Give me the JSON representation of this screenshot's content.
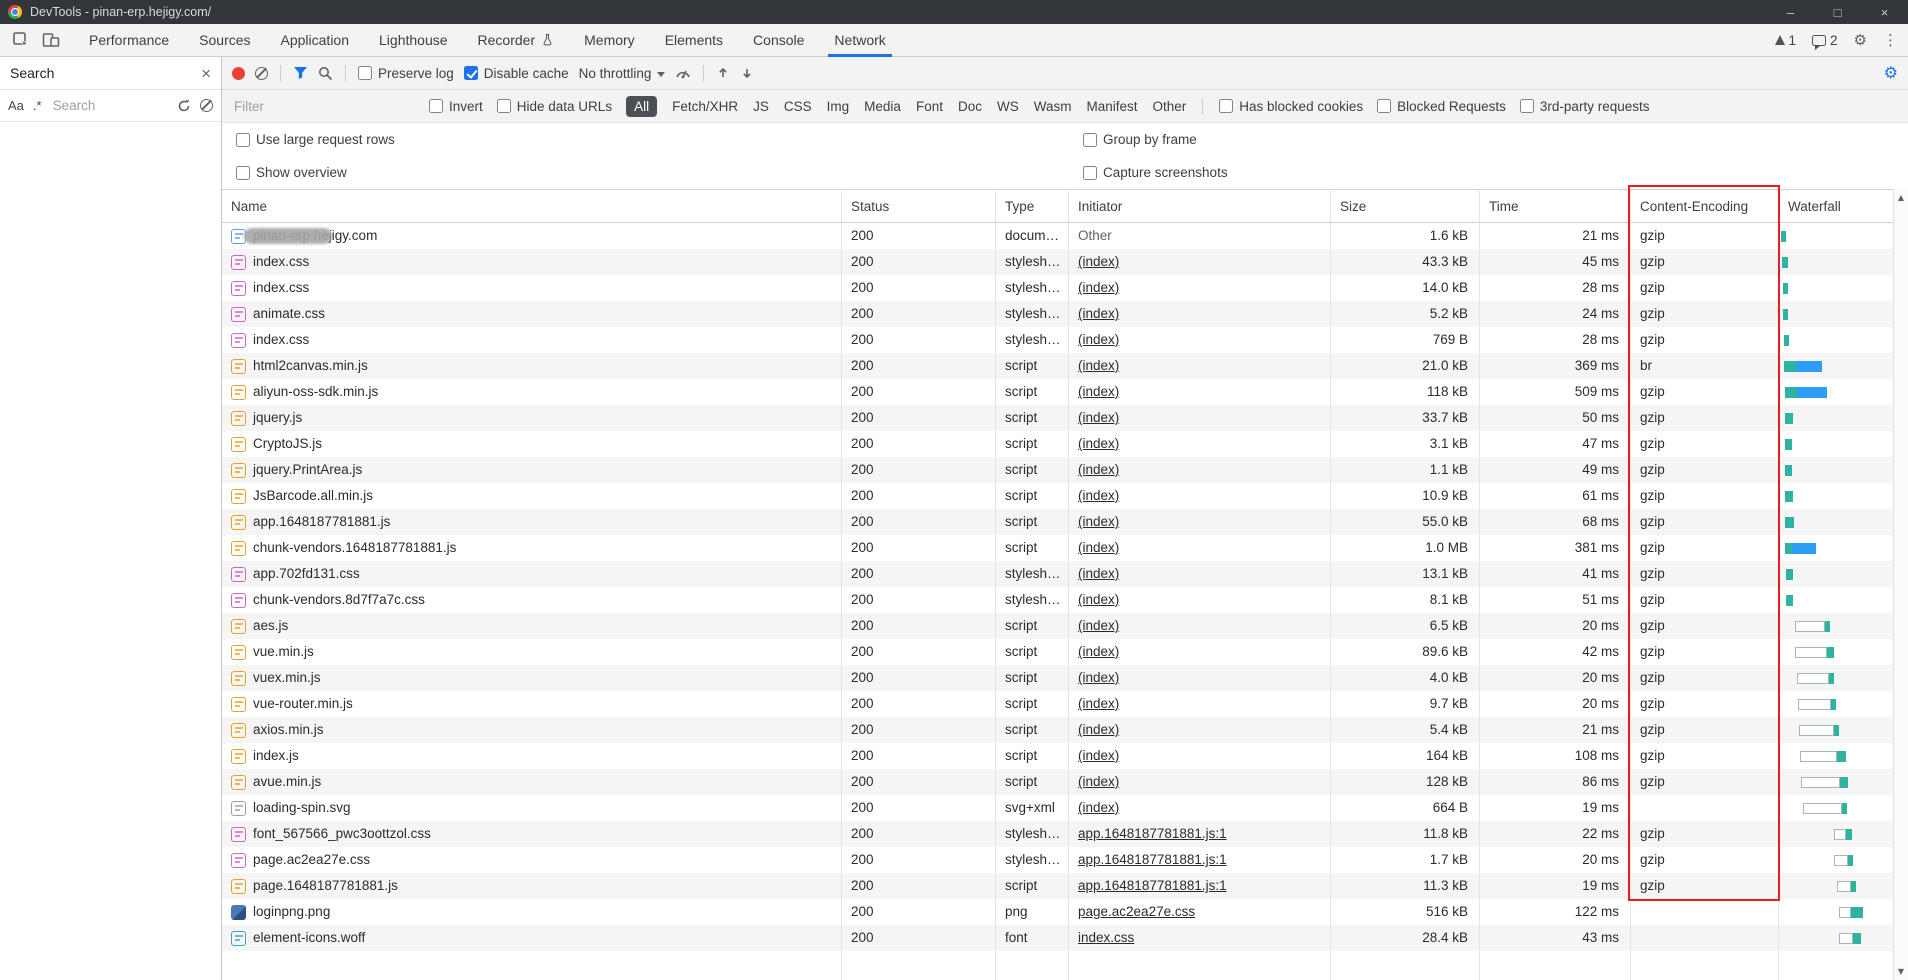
{
  "window": {
    "title": "DevTools - pinan-erp.hejigy.com/",
    "controls": {
      "minimize": "–",
      "maximize": "□",
      "close": "×"
    }
  },
  "tabbar": {
    "tabs": [
      {
        "label": "Performance"
      },
      {
        "label": "Sources"
      },
      {
        "label": "Application"
      },
      {
        "label": "Lighthouse"
      },
      {
        "label": "Recorder",
        "icon": "flask"
      },
      {
        "label": "Memory"
      },
      {
        "label": "Elements"
      },
      {
        "label": "Console"
      },
      {
        "label": "Network",
        "active": true
      }
    ],
    "warning_count": "1",
    "message_count": "2"
  },
  "search_panel": {
    "title": "Search",
    "match_case_label": "Aa",
    "regex_label": ".*",
    "input_placeholder": "Search"
  },
  "network_toolbar": {
    "preserve_log_label": "Preserve log",
    "disable_cache_label": "Disable cache",
    "throttling_value": "No throttling"
  },
  "filter_bar": {
    "filter_placeholder": "Filter",
    "invert_label": "Invert",
    "hide_data_urls_label": "Hide data URLs",
    "type_filters": [
      "All",
      "Fetch/XHR",
      "JS",
      "CSS",
      "Img",
      "Media",
      "Font",
      "Doc",
      "WS",
      "Wasm",
      "Manifest",
      "Other"
    ],
    "selected_filter": "All",
    "has_blocked_cookies_label": "Has blocked cookies",
    "blocked_requests_label": "Blocked Requests",
    "third_party_label": "3rd-party requests"
  },
  "view_options": {
    "use_large_request_rows": "Use large request rows",
    "group_by_frame": "Group by frame",
    "show_overview": "Show overview",
    "capture_screenshots": "Capture screenshots"
  },
  "annotation": {
    "highlighted_column": "Content-Encoding"
  },
  "table": {
    "columns": [
      "Name",
      "Status",
      "Type",
      "Initiator",
      "Size",
      "Time",
      "Content-Encoding",
      "Waterfall"
    ],
    "rows": [
      {
        "name": "pinan-erp.hejigy.com",
        "icon": "doc",
        "status": "200",
        "type": "docum…",
        "initiator": "Other",
        "link": false,
        "size": "1.6 kB",
        "time": "21 ms",
        "encoding": "gzip",
        "wf": [
          2,
          0,
          5,
          0
        ],
        "redacted": true
      },
      {
        "name": "index.css",
        "icon": "css",
        "status": "200",
        "type": "stylesh…",
        "initiator": "(index)",
        "link": true,
        "size": "43.3 kB",
        "time": "45 ms",
        "encoding": "gzip",
        "wf": [
          3,
          0,
          6,
          0
        ]
      },
      {
        "name": "index.css",
        "icon": "css",
        "status": "200",
        "type": "stylesh…",
        "initiator": "(index)",
        "link": true,
        "size": "14.0 kB",
        "time": "28 ms",
        "encoding": "gzip",
        "wf": [
          4,
          0,
          5,
          0
        ]
      },
      {
        "name": "animate.css",
        "icon": "css",
        "status": "200",
        "type": "stylesh…",
        "initiator": "(index)",
        "link": true,
        "size": "5.2 kB",
        "time": "24 ms",
        "encoding": "gzip",
        "wf": [
          4,
          0,
          5,
          0
        ]
      },
      {
        "name": "index.css",
        "icon": "css",
        "status": "200",
        "type": "stylesh…",
        "initiator": "(index)",
        "link": true,
        "size": "769 B",
        "time": "28 ms",
        "encoding": "gzip",
        "wf": [
          5,
          0,
          5,
          0
        ]
      },
      {
        "name": "html2canvas.min.js",
        "icon": "js",
        "status": "200",
        "type": "script",
        "initiator": "(index)",
        "link": true,
        "size": "21.0 kB",
        "time": "369 ms",
        "encoding": "br",
        "wf": [
          5,
          0,
          12,
          26
        ]
      },
      {
        "name": "aliyun-oss-sdk.min.js",
        "icon": "js",
        "status": "200",
        "type": "script",
        "initiator": "(index)",
        "link": true,
        "size": "118 kB",
        "time": "509 ms",
        "encoding": "gzip",
        "wf": [
          6,
          0,
          12,
          30
        ]
      },
      {
        "name": "jquery.js",
        "icon": "js",
        "status": "200",
        "type": "script",
        "initiator": "(index)",
        "link": true,
        "size": "33.7 kB",
        "time": "50 ms",
        "encoding": "gzip",
        "wf": [
          6,
          0,
          8,
          0
        ]
      },
      {
        "name": "CryptoJS.js",
        "icon": "js",
        "status": "200",
        "type": "script",
        "initiator": "(index)",
        "link": true,
        "size": "3.1 kB",
        "time": "47 ms",
        "encoding": "gzip",
        "wf": [
          6,
          0,
          7,
          0
        ]
      },
      {
        "name": "jquery.PrintArea.js",
        "icon": "js",
        "status": "200",
        "type": "script",
        "initiator": "(index)",
        "link": true,
        "size": "1.1 kB",
        "time": "49 ms",
        "encoding": "gzip",
        "wf": [
          6,
          0,
          7,
          0
        ]
      },
      {
        "name": "JsBarcode.all.min.js",
        "icon": "js",
        "status": "200",
        "type": "script",
        "initiator": "(index)",
        "link": true,
        "size": "10.9 kB",
        "time": "61 ms",
        "encoding": "gzip",
        "wf": [
          6,
          0,
          8,
          0
        ]
      },
      {
        "name": "app.1648187781881.js",
        "icon": "js",
        "status": "200",
        "type": "script",
        "initiator": "(index)",
        "link": true,
        "size": "55.0 kB",
        "time": "68 ms",
        "encoding": "gzip",
        "wf": [
          6,
          0,
          9,
          0
        ]
      },
      {
        "name": "chunk-vendors.1648187781881.js",
        "icon": "js",
        "status": "200",
        "type": "script",
        "initiator": "(index)",
        "link": true,
        "size": "1.0 MB",
        "time": "381 ms",
        "encoding": "gzip",
        "wf": [
          6,
          0,
          7,
          24
        ]
      },
      {
        "name": "app.702fd131.css",
        "icon": "css",
        "status": "200",
        "type": "stylesh…",
        "initiator": "(index)",
        "link": true,
        "size": "13.1 kB",
        "time": "41 ms",
        "encoding": "gzip",
        "wf": [
          7,
          0,
          7,
          0
        ]
      },
      {
        "name": "chunk-vendors.8d7f7a7c.css",
        "icon": "css",
        "status": "200",
        "type": "stylesh…",
        "initiator": "(index)",
        "link": true,
        "size": "8.1 kB",
        "time": "51 ms",
        "encoding": "gzip",
        "wf": [
          7,
          0,
          7,
          0
        ]
      },
      {
        "name": "aes.js",
        "icon": "js",
        "status": "200",
        "type": "script",
        "initiator": "(index)",
        "link": true,
        "size": "6.5 kB",
        "time": "20 ms",
        "encoding": "gzip",
        "wf": [
          16,
          30,
          5,
          0
        ]
      },
      {
        "name": "vue.min.js",
        "icon": "js",
        "status": "200",
        "type": "script",
        "initiator": "(index)",
        "link": true,
        "size": "89.6 kB",
        "time": "42 ms",
        "encoding": "gzip",
        "wf": [
          16,
          32,
          7,
          0
        ]
      },
      {
        "name": "vuex.min.js",
        "icon": "js",
        "status": "200",
        "type": "script",
        "initiator": "(index)",
        "link": true,
        "size": "4.0 kB",
        "time": "20 ms",
        "encoding": "gzip",
        "wf": [
          18,
          32,
          5,
          0
        ]
      },
      {
        "name": "vue-router.min.js",
        "icon": "js",
        "status": "200",
        "type": "script",
        "initiator": "(index)",
        "link": true,
        "size": "9.7 kB",
        "time": "20 ms",
        "encoding": "gzip",
        "wf": [
          19,
          33,
          5,
          0
        ]
      },
      {
        "name": "axios.min.js",
        "icon": "js",
        "status": "200",
        "type": "script",
        "initiator": "(index)",
        "link": true,
        "size": "5.4 kB",
        "time": "21 ms",
        "encoding": "gzip",
        "wf": [
          20,
          35,
          5,
          0
        ]
      },
      {
        "name": "index.js",
        "icon": "js",
        "status": "200",
        "type": "script",
        "initiator": "(index)",
        "link": true,
        "size": "164 kB",
        "time": "108 ms",
        "encoding": "gzip",
        "wf": [
          21,
          37,
          9,
          0
        ]
      },
      {
        "name": "avue.min.js",
        "icon": "js",
        "status": "200",
        "type": "script",
        "initiator": "(index)",
        "link": true,
        "size": "128 kB",
        "time": "86 ms",
        "encoding": "gzip",
        "wf": [
          22,
          39,
          8,
          0
        ]
      },
      {
        "name": "loading-spin.svg",
        "icon": "svg",
        "status": "200",
        "type": "svg+xml",
        "initiator": "(index)",
        "link": true,
        "size": "664 B",
        "time": "19 ms",
        "encoding": "",
        "wf": [
          24,
          39,
          5,
          0
        ]
      },
      {
        "name": "font_567566_pwc3oottzol.css",
        "icon": "css",
        "status": "200",
        "type": "stylesh…",
        "initiator": "app.1648187781881.js:1",
        "link": true,
        "size": "11.8 kB",
        "time": "22 ms",
        "encoding": "gzip",
        "wf": [
          55,
          12,
          6,
          0
        ]
      },
      {
        "name": "page.ac2ea27e.css",
        "icon": "css",
        "status": "200",
        "type": "stylesh…",
        "initiator": "app.1648187781881.js:1",
        "link": true,
        "size": "1.7 kB",
        "time": "20 ms",
        "encoding": "gzip",
        "wf": [
          55,
          14,
          5,
          0
        ]
      },
      {
        "name": "page.1648187781881.js",
        "icon": "js",
        "status": "200",
        "type": "script",
        "initiator": "app.1648187781881.js:1",
        "link": true,
        "size": "11.3 kB",
        "time": "19 ms",
        "encoding": "gzip",
        "wf": [
          58,
          14,
          5,
          0
        ]
      },
      {
        "name": "loginpng.png",
        "icon": "img",
        "status": "200",
        "type": "png",
        "initiator": "page.ac2ea27e.css",
        "link": true,
        "size": "516 kB",
        "time": "122 ms",
        "encoding": "",
        "wf": [
          60,
          12,
          12,
          0
        ]
      },
      {
        "name": "element-icons.woff",
        "icon": "font",
        "status": "200",
        "type": "font",
        "initiator": "index.css",
        "link": true,
        "size": "28.4 kB",
        "time": "43 ms",
        "encoding": "",
        "wf": [
          60,
          14,
          8,
          0
        ]
      }
    ]
  },
  "colors": {
    "accent": "#1a73e8",
    "record": "#e94235",
    "highlight": "#ee1c1c",
    "wf_teal": "#2eb3a1",
    "wf_blue": "#2d9df5"
  }
}
